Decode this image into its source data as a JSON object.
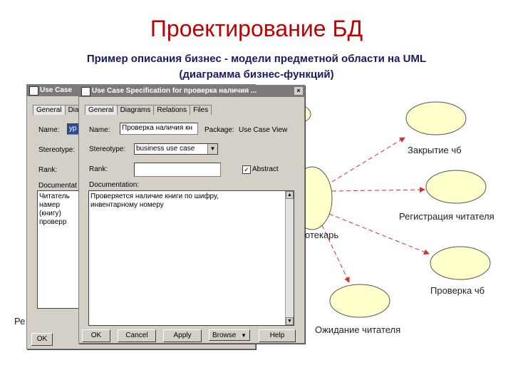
{
  "slide": {
    "title": "Проектирование БД",
    "subtitle_line1": "Пример описания бизнес - модели предметной области на UML",
    "subtitle_line2": "(диаграмма бизнес-функций)"
  },
  "diagram": {
    "colors": {
      "ellipse_fill": "#ffffcc",
      "arrow": "#cc3333"
    },
    "use_cases": [
      {
        "id": "close",
        "label": "Закрытие чб"
      },
      {
        "id": "register",
        "label": "Регистрация читателя"
      },
      {
        "id": "check",
        "label": "Проверка чб"
      },
      {
        "id": "wait",
        "label": "Ожидание читателя"
      }
    ],
    "actor_label_fragment": "отекарь",
    "left_label_fragment": "Ре"
  },
  "back_window": {
    "title": "Use Case",
    "tabs": [
      "General",
      "Dia"
    ],
    "labels": {
      "name": "Name:",
      "stereotype": "Stereotype:",
      "rank": "Rank:",
      "documentation": "Documentat"
    },
    "name_value": "ур",
    "doc_text_line1": "Читатель намер",
    "doc_text_line2": "(книгу) проверр",
    "ok_button": "OK"
  },
  "front_window": {
    "title": "Use Case Specification for проверка наличия ...",
    "close_glyph": "×",
    "tabs": [
      "General",
      "Diagrams",
      "Relations",
      "Files"
    ],
    "labels": {
      "name": "Name:",
      "package": "Package:",
      "stereotype": "Stereotype:",
      "rank": "Rank:",
      "abstract": "Abstract",
      "documentation": "Documentation:"
    },
    "name_value": "Проверка наличия кн",
    "package_value": "Use Case View",
    "stereotype_value": "business use case",
    "rank_value": "",
    "abstract_checked": true,
    "doc_text_line1": "Проверяется наличие книги по шифру,",
    "doc_text_line2": "инвентарному номеру",
    "buttons": {
      "ok": "OK",
      "cancel": "Cancel",
      "apply": "Apply",
      "browse": "Browse",
      "help": "Help"
    }
  }
}
